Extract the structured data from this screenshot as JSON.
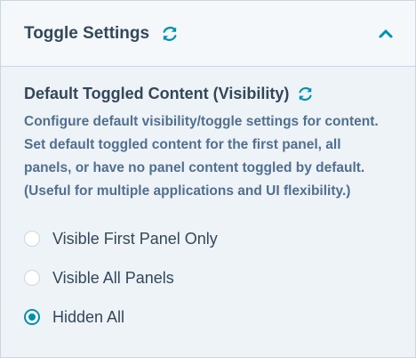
{
  "header": {
    "title": "Toggle Settings",
    "reset_icon": "refresh-icon",
    "collapse_icon": "chevron-up-icon"
  },
  "section": {
    "title": "Default Toggled Content (Visibility)",
    "reset_icon": "refresh-icon",
    "description": "Configure default visibility/toggle settings for content. Set default toggled content for the first panel, all panels, or have no panel content toggled by default. (Useful for multiple applications and UI flexibility.)"
  },
  "options": [
    {
      "label": "Visible First Panel Only",
      "checked": false
    },
    {
      "label": "Visible All Panels",
      "checked": false
    },
    {
      "label": "Hidden All",
      "checked": true
    }
  ],
  "colors": {
    "accent": "#0091ae",
    "text": "#33475b",
    "muted_text": "#516f90",
    "background": "#eef3f8"
  }
}
